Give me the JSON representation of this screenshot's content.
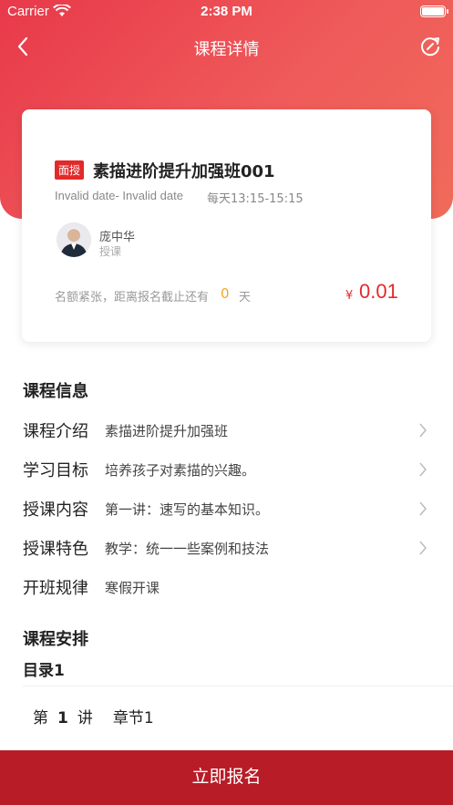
{
  "status_bar": {
    "carrier": "Carrier",
    "time": "2:38 PM"
  },
  "nav": {
    "title": "课程详情",
    "back_icon": "chevron-left-icon",
    "share_icon": "refresh-icon"
  },
  "course": {
    "tag": "面授",
    "title": "素描进阶提升加强班001",
    "date_range": "Invalid date- Invalid date",
    "schedule_time": "每天13:15-15:15",
    "teacher": {
      "name": "庞中华",
      "role": "授课"
    },
    "deadline_text": "名额紧张，距离报名截止还有",
    "deadline_days": "0",
    "deadline_unit": "天",
    "price_symbol": "¥",
    "price": "0.01"
  },
  "info": {
    "heading": "课程信息",
    "rows": [
      {
        "label": "课程介绍",
        "value": "素描进阶提升加强班",
        "has_arrow": true
      },
      {
        "label": "学习目标",
        "value": "培养孩子对素描的兴趣。",
        "has_arrow": true
      },
      {
        "label": "授课内容",
        "value": "第一讲：速写的基本知识。",
        "has_arrow": true
      },
      {
        "label": "授课特色",
        "value": "教学：统一一些案例和技法",
        "has_arrow": true
      },
      {
        "label": "开班规律",
        "value": "寒假开课",
        "has_arrow": false
      }
    ]
  },
  "schedule": {
    "heading": "课程安排",
    "catalog_title": "目录1",
    "lessons": [
      {
        "prefix": "第",
        "number": "1",
        "suffix": "讲",
        "name": "章节1"
      }
    ]
  },
  "footer": {
    "enroll_label": "立即报名"
  },
  "colors": {
    "brand_red": "#e8394a",
    "button_red": "#b81c26",
    "price_red": "#e22a2a",
    "days_orange": "#f5a623"
  }
}
